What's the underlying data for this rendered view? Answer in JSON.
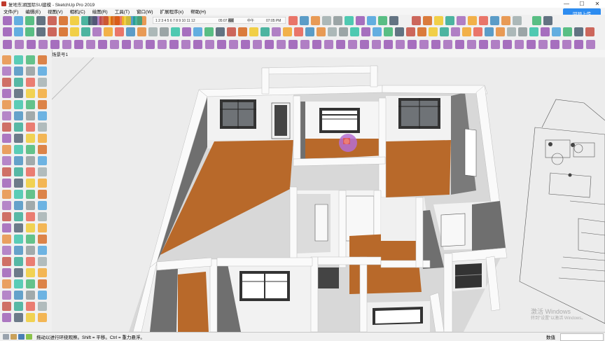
{
  "window": {
    "title": "复地东湖国际SU建模 - SketchUp Pro 2019",
    "controls": {
      "minimize": "—",
      "maximize": "☐",
      "close": "✕"
    }
  },
  "menu": {
    "items": [
      "文件(F)",
      "编辑(E)",
      "视图(V)",
      "相机(C)",
      "绘图(R)",
      "工具(T)",
      "窗口(W)",
      "扩展程序(x)",
      "帮助(H)"
    ]
  },
  "shadow_bar": {
    "months": "1 2 3 4 5 6 7 8 9 10 11 12",
    "time_start": "05:07 AM",
    "noon": "中午",
    "time_end": "07:05 PM"
  },
  "login_button": "回顾上传",
  "scene_tab": "场景号1",
  "status": {
    "message": "拖动以进行环绕观察。Shift = 平移。Ctrl = 重力悬浮。",
    "measurements_label": "数值"
  },
  "watermark": {
    "line1": "激活 Windows",
    "line2": "转到\"设置\"以激活 Windows。"
  },
  "colors": {
    "floor": "#b8692a",
    "wall_top": "#f7f7f7",
    "wall_inner": "#757575",
    "orbit_cursor": "#8e44ad"
  }
}
